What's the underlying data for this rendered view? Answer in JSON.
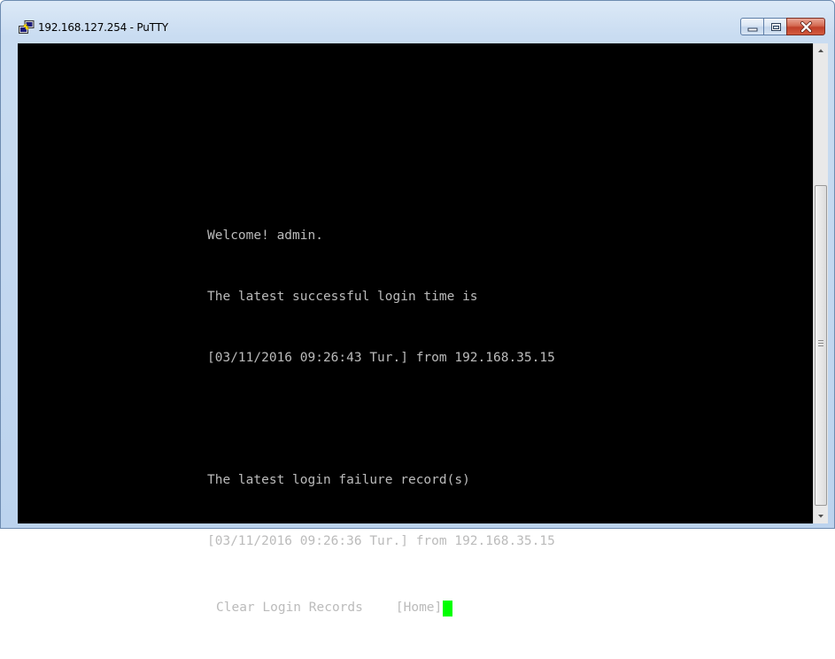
{
  "window": {
    "title": "192.168.127.254 - PuTTY",
    "icon": "putty-icon",
    "caption_buttons": [
      "minimize",
      "maximize",
      "close"
    ]
  },
  "terminal": {
    "lines": [
      "Welcome! admin.",
      "The latest successful login time is",
      "[03/11/2016 09:26:43 Tur.] from 192.168.35.15",
      "",
      "The latest login failure record(s)",
      "[03/11/2016 09:26:36 Tur.] from 192.168.35.15"
    ],
    "menu": {
      "clear_label": "Clear Login Records",
      "home_label": "[Home]"
    },
    "colors": {
      "background": "#000000",
      "text": "#bbbbbb",
      "cursor": "#00ff00"
    }
  },
  "scrollbar": {
    "icons": [
      "scroll-up-arrow-icon",
      "scroll-thumb-grip-icon",
      "scroll-down-arrow-icon"
    ]
  }
}
